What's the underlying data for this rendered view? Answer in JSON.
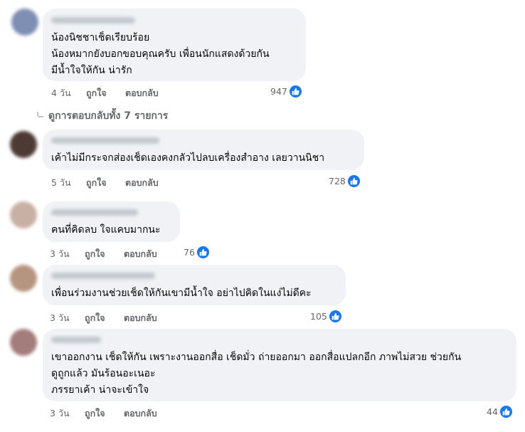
{
  "comments": [
    {
      "lines": [
        "น้องนิชชาเช็ดเรียบร้อย",
        "น้องหมากยังบอกขอบคุณครับ เพื่อนนักแสดงด้วยกัน",
        "มีน้ำใจให้กัน น่ารัก"
      ],
      "time": "4 วัน",
      "like": "ถูกใจ",
      "reply": "ตอบกลับ",
      "reactions": "947"
    },
    {
      "lines": [
        "เค้าไม่มีกระจกส่องเช็ดเองคงกลัวไปลบเครื่องสำอาง เลยวานนิชา"
      ],
      "time": "5 วัน",
      "like": "ถูกใจ",
      "reply": "ตอบกลับ",
      "reactions": "728"
    },
    {
      "lines": [
        "คนที่คิดลบ ใจแคบมากนะ"
      ],
      "time": "3 วัน",
      "like": "ถูกใจ",
      "reply": "ตอบกลับ",
      "reactions": "76"
    },
    {
      "lines": [
        "เพื่อนร่วมงานช่วยเช็ดให้กันเขามีน้ำใจ อย่าไปคิดในแง่ไม่ดีคะ"
      ],
      "time": "3 วัน",
      "like": "ถูกใจ",
      "reply": "ตอบกลับ",
      "reactions": "105"
    },
    {
      "lines": [
        "เขาออกงาน เช็ดให้กัน เพราะงานออกสื่อ เช็ดมั่ว ถ่ายออกมา ออกสื่อแปลกอีก ภาพไม่สวย ช่วยกัน",
        "ดูถูกแล้ว มันร้อนอะเนอะ",
        "ภรรยาเค้า น่าจะเข้าใจ"
      ],
      "time": "3 วัน",
      "like": "ถูกใจ",
      "reply": "ตอบกลับ",
      "reactions": "44"
    }
  ],
  "view_replies": "ดูการตอบกลับทั้ง 7 รายการ",
  "colors": {
    "bubble": "#f0f2f5",
    "like_blue": "#1877f2",
    "meta": "#65676b"
  }
}
